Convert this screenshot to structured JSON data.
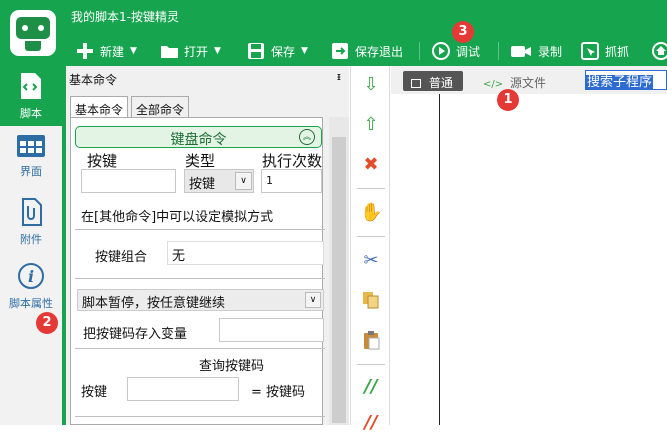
{
  "window": {
    "title": "我的脚本1-按键精灵"
  },
  "toolbar": {
    "new_label": "新建",
    "open_label": "打开",
    "save_label": "保存",
    "save_exit_label": "保存退出",
    "debug_label": "调试",
    "record_label": "录制",
    "capture_label": "抓抓"
  },
  "leftnav": {
    "items": [
      {
        "label": "脚本"
      },
      {
        "label": "界面"
      },
      {
        "label": "附件"
      },
      {
        "label": "脚本属性"
      }
    ]
  },
  "panel": {
    "title": "基本命令",
    "pin_glyph": "ᵻ",
    "tabs": [
      "基本命令",
      "全部命令"
    ],
    "keyboard_header": "键盘命令",
    "col_key": "按键",
    "col_type": "类型",
    "col_times": "执行次数",
    "type_value": "按键",
    "times_value": "1",
    "hint": "在[其他命令]中可以设定模拟方式",
    "combo_label": "按键组合",
    "combo_value": "无",
    "pause_select": "脚本暂停，按任意键继续",
    "store_label": "把按键码存入变量",
    "query_title": "查询按键码",
    "query_key_label": "按键",
    "query_result": "= 按键码"
  },
  "editor": {
    "tab_normal": "普通",
    "tab_source": "源文件",
    "search_text": "搜索子程序"
  },
  "markers": [
    "1",
    "2",
    "3"
  ],
  "colors": {
    "brand": "#17a44f",
    "marker": "#e53935",
    "selection": "#2d6bd0"
  }
}
